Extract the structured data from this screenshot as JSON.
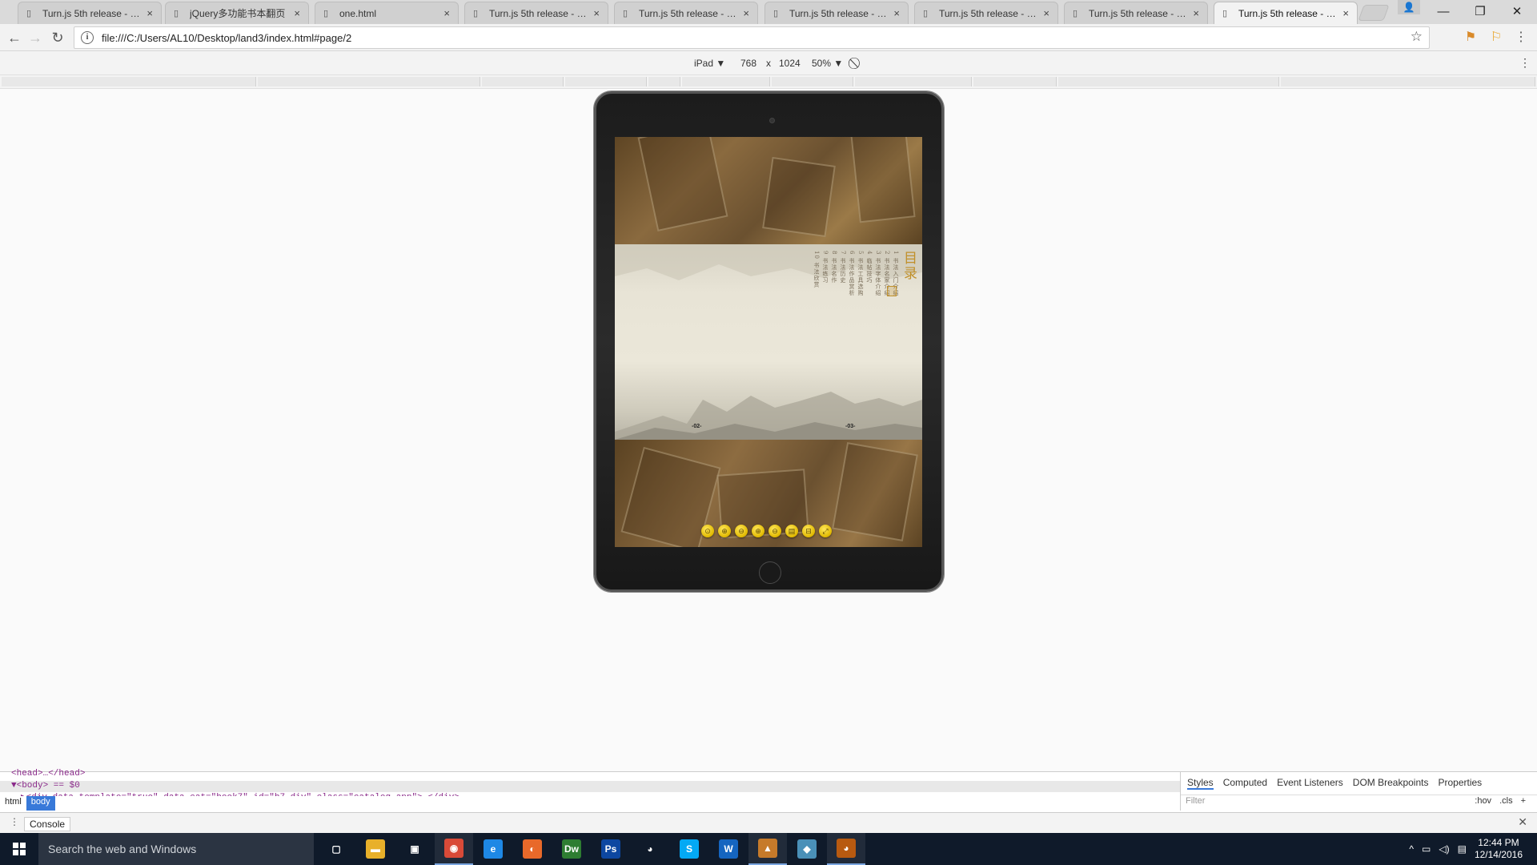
{
  "browser": {
    "tabs": [
      {
        "label": "Turn.js 5th release - HTML",
        "icon": "page-icon",
        "active": false
      },
      {
        "label": "jQuery多功能书本翻页",
        "icon": "page-icon",
        "active": false
      },
      {
        "label": "one.html",
        "icon": "page-icon",
        "active": false
      },
      {
        "label": "Turn.js 5th release - HTML",
        "icon": "page-icon",
        "active": false
      },
      {
        "label": "Turn.js 5th release - HTML",
        "icon": "page-icon",
        "active": false
      },
      {
        "label": "Turn.js 5th release - HTML",
        "icon": "page-icon",
        "active": false
      },
      {
        "label": "Turn.js 5th release - HTML",
        "icon": "page-icon",
        "active": false
      },
      {
        "label": "Turn.js 5th release - HTML",
        "icon": "page-icon",
        "active": false
      },
      {
        "label": "Turn.js 5th release - HTML",
        "icon": "page-icon",
        "active": true
      }
    ],
    "close_glyph": "×",
    "url": "file:///C:/Users/AL10/Desktop/land3/index.html#page/2"
  },
  "device_toolbar": {
    "device": "iPad ▼",
    "width": "768",
    "times": "x",
    "height": "1024",
    "zoom": "50% ▼"
  },
  "book": {
    "toc_title": "目录",
    "toc_columns": [
      "1 书法入门介绍",
      "2 书法名家介绍",
      "3 书法字体介绍",
      "4 临帖技巧",
      "5 书法工具选购",
      "6 书法作品赏析",
      "7 书法历史",
      "8 书法名作",
      "9 书法练习",
      "10 书法欣赏"
    ],
    "left_page_number": "-02-",
    "right_page_number": "-03-",
    "controls": [
      "⊙",
      "⊕",
      "⊖",
      "⊕",
      "⊖",
      "▤",
      "⊟",
      "⤢"
    ]
  },
  "devtools": {
    "dom_lines": [
      "<head>…</head>",
      "▼<body> == $0",
      "▶<div data-template=\"true\" data-cat=\"book7\" id=\"b7-div\" class=\"catalog-app\">…</div>"
    ],
    "breadcrumbs": [
      "html",
      "body"
    ],
    "side_tabs": [
      "Styles",
      "Computed",
      "Event Listeners",
      "DOM Breakpoints",
      "Properties"
    ],
    "filter_placeholder": "Filter",
    "filter_actions": [
      ":hov",
      ".cls",
      "+"
    ],
    "console_tab": "Console"
  },
  "taskbar": {
    "search_placeholder": "Search the web and Windows",
    "time": "12:44 PM",
    "date": "12/14/2016",
    "apps": [
      {
        "name": "task-view-icon",
        "glyph": "▢",
        "color": "#0f1a2a",
        "running": false
      },
      {
        "name": "file-explorer-icon",
        "glyph": "▬",
        "color": "#e8b02a",
        "running": false
      },
      {
        "name": "store-icon",
        "glyph": "▣",
        "color": "#0f1a2a",
        "running": false
      },
      {
        "name": "chrome-icon",
        "glyph": "◉",
        "color": "#d94a38",
        "running": true
      },
      {
        "name": "edge-icon",
        "glyph": "e",
        "color": "#1e88e5",
        "running": false
      },
      {
        "name": "firefox-icon",
        "glyph": "◐",
        "color": "#e8692a",
        "running": false
      },
      {
        "name": "dreamweaver-icon",
        "glyph": "Dw",
        "color": "#2e7d32",
        "running": false
      },
      {
        "name": "photoshop-icon",
        "glyph": "Ps",
        "color": "#0d47a1",
        "running": false
      },
      {
        "name": "qq-icon",
        "glyph": "◕",
        "color": "#0f1a2a",
        "running": false
      },
      {
        "name": "skype-icon",
        "glyph": "S",
        "color": "#03a9f4",
        "running": false
      },
      {
        "name": "word-icon",
        "glyph": "W",
        "color": "#1565c0",
        "running": false
      },
      {
        "name": "photos-icon",
        "glyph": "▲",
        "color": "#c67a2a",
        "running": true
      },
      {
        "name": "app-icon",
        "glyph": "◆",
        "color": "#4a90b8",
        "running": false
      },
      {
        "name": "qq-app-icon",
        "glyph": "◕",
        "color": "#b85a10",
        "running": true
      }
    ]
  }
}
